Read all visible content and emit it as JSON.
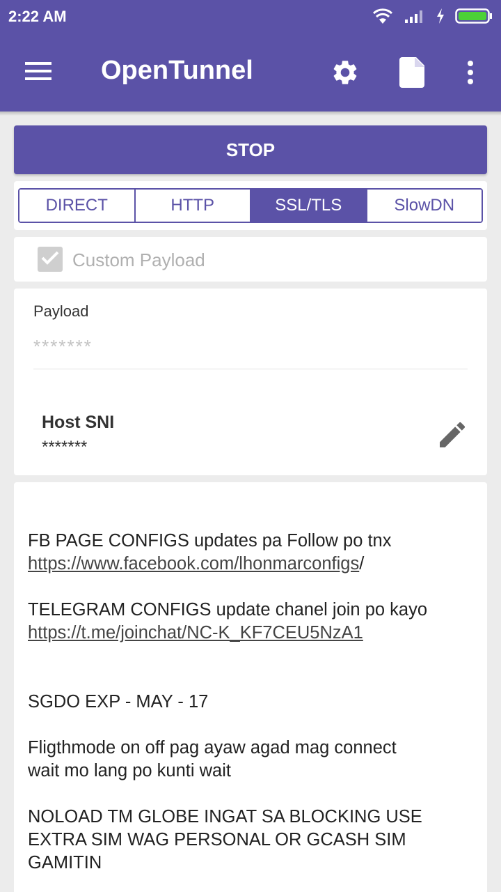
{
  "status_bar": {
    "time": "2:22 AM",
    "icons": [
      "wifi-icon",
      "signal-icon",
      "charging-icon",
      "battery-icon"
    ]
  },
  "toolbar": {
    "title": "OpenTunnel",
    "icons": [
      "menu-icon",
      "settings-gear-icon",
      "document-icon",
      "more-vert-icon"
    ]
  },
  "colors": {
    "primary": "#5b52a7",
    "background": "#ececec",
    "battery": "#4cd137"
  },
  "actions": {
    "stop_label": "STOP"
  },
  "tabs": [
    {
      "label": "DIRECT",
      "active": false
    },
    {
      "label": "HTTP",
      "active": false
    },
    {
      "label": "SSL/TLS",
      "active": true
    },
    {
      "label": "SlowDN",
      "active": false
    }
  ],
  "custom_payload": {
    "label": "Custom Payload",
    "checked": true,
    "disabled": true
  },
  "payload": {
    "label": "Payload",
    "value": "*******"
  },
  "host_sni": {
    "label": "Host SNI",
    "value": "*******"
  },
  "message": {
    "fb_text": "FB PAGE CONFIGS updates pa Follow po tnx",
    "fb_link": "https://www.facebook.com/lhonmarconfigs",
    "fb_link_suffix": "/",
    "tg_text": "TELEGRAM CONFIGS update chanel join po kayo",
    "tg_link": "https://t.me/joinchat/NC-K_KF7CEU5NzA1",
    "sgdo": "SGDO EXP - MAY - 17",
    "flight_line1": "Fligthmode on off pag ayaw agad mag connect",
    "flight_line2": "wait mo lang po kunti wait",
    "noload_line1": "NOLOAD TM GLOBE INGAT SA BLOCKING USE",
    "noload_line2": "EXTRA SIM WAG PERSONAL OR GCASH SIM",
    "noload_line3": "GAMITIN"
  }
}
